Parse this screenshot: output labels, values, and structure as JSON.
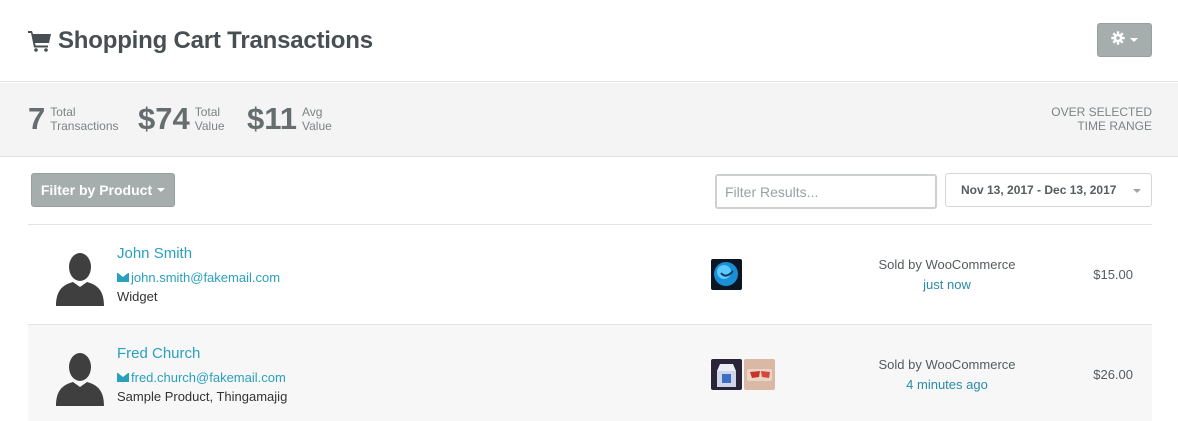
{
  "header": {
    "title": "Shopping Cart Transactions",
    "cart_icon": "shopping-cart-icon",
    "settings_icon": "gear-icon"
  },
  "stats": {
    "transactions": {
      "value": "7",
      "label_line1": "Total",
      "label_line2": "Transactions"
    },
    "total_value": {
      "value": "$74",
      "label_line1": "Total",
      "label_line2": "Value"
    },
    "avg_value": {
      "value": "$11",
      "label_line1": "Avg",
      "label_line2": "Value"
    },
    "range_line1": "OVER SELECTED",
    "range_line2": "TIME RANGE"
  },
  "toolbar": {
    "filter_product_label": "Filter by Product",
    "filter_placeholder": "Filter Results...",
    "date_range": "Nov 13, 2017 - Dec 13, 2017"
  },
  "transactions": [
    {
      "name": "John Smith",
      "email": "john.smith@fakemail.com",
      "products": "Widget",
      "sold_by": "Sold by WooCommerce",
      "time": "just now",
      "amount": "$15.00"
    },
    {
      "name": "Fred Church",
      "email": "fred.church@fakemail.com",
      "products": "Sample Product, Thingamajig",
      "sold_by": "Sold by WooCommerce",
      "time": "4 minutes ago",
      "amount": "$26.00"
    }
  ],
  "colors": {
    "accent": "#2aa0bf",
    "button_gray": "#a5adad",
    "stats_bg": "#f4f4f4"
  }
}
